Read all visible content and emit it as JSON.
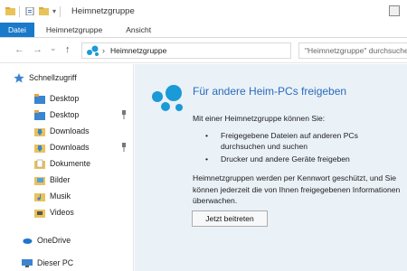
{
  "window": {
    "title": "Heimnetzgruppe",
    "folder_color": "#e8c35a"
  },
  "ribbon": {
    "tabs": [
      {
        "label": "Datei"
      },
      {
        "label": "Heimnetzgruppe"
      },
      {
        "label": "Ansicht"
      }
    ],
    "accent": "#1979ca"
  },
  "address": {
    "path": "Heimnetzgruppe",
    "nav": {
      "back": "←",
      "forward": "→",
      "up": "↑",
      "recent": "⌄"
    },
    "search_text": "\"Heimnetzgruppe\" durchsuchen"
  },
  "sidebar": {
    "items": [
      {
        "label": "Schnellzugriff",
        "icon": "star-icon"
      },
      {
        "label": "Desktop",
        "icon": "desktop-folder-icon"
      },
      {
        "label": "Desktop",
        "icon": "desktop-folder-icon",
        "pinned": true
      },
      {
        "label": "Downloads",
        "icon": "downloads-folder-icon"
      },
      {
        "label": "Downloads",
        "icon": "downloads-folder-icon",
        "pinned": true
      },
      {
        "label": "Dokumente",
        "icon": "documents-folder-icon"
      },
      {
        "label": "Bilder",
        "icon": "pictures-folder-icon"
      },
      {
        "label": "Musik",
        "icon": "music-folder-icon"
      },
      {
        "label": "Videos",
        "icon": "videos-folder-icon"
      },
      {
        "label": "OneDrive",
        "icon": "cloud-icon"
      },
      {
        "label": "Dieser PC",
        "icon": "computer-icon"
      }
    ]
  },
  "main": {
    "heading": "Für andere Heim-PCs freigeben",
    "intro": "Mit einer Heimnetzgruppe können Sie:",
    "bullets": [
      "Freigegebene Dateien auf anderen PCs durchsuchen und suchen",
      "Drucker und andere Geräte freigeben"
    ],
    "bullet_glyph": "•",
    "note": "Heimnetzgruppen werden per Kennwort geschützt, und Sie können jederzeit die von Ihnen freigegebenen Informationen überwachen.",
    "join_button": "Jetzt beitreten",
    "heading_color": "#2a6bbd",
    "logo_color": "#1a9ad6"
  }
}
